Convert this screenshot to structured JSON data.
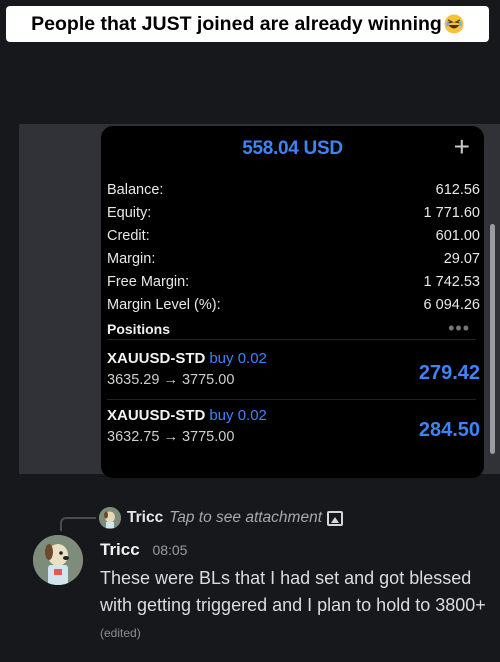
{
  "caption": {
    "text": "People that JUST joined are already winning"
  },
  "panel": {
    "header": "558.04 USD",
    "plus": "+",
    "rows": [
      {
        "label": "Balance:",
        "value": "612.56"
      },
      {
        "label": "Equity:",
        "value": "1 771.60"
      },
      {
        "label": "Credit:",
        "value": "601.00"
      },
      {
        "label": "Margin:",
        "value": "29.07"
      },
      {
        "label": "Free Margin:",
        "value": "1 742.53"
      },
      {
        "label": "Margin Level (%):",
        "value": "6 094.26"
      }
    ],
    "positions_label": "Positions",
    "more": "•••",
    "positions": [
      {
        "symbol": "XAUUSD-STD",
        "side": "buy 0.02",
        "prices": "3635.29 → 3775.00",
        "profit": "279.42"
      },
      {
        "symbol": "XAUUSD-STD",
        "side": "buy 0.02",
        "prices": "3632.75 → 3775.00",
        "profit": "284.50"
      }
    ]
  },
  "chat": {
    "reply": {
      "name": "Tricc",
      "text": "Tap to see attachment"
    },
    "message": {
      "author": "Tricc",
      "time": "08:05",
      "text": "These were BLs that I had set and got blessed with getting triggered and I plan to hold to 3800+",
      "edited": "(edited)"
    }
  }
}
